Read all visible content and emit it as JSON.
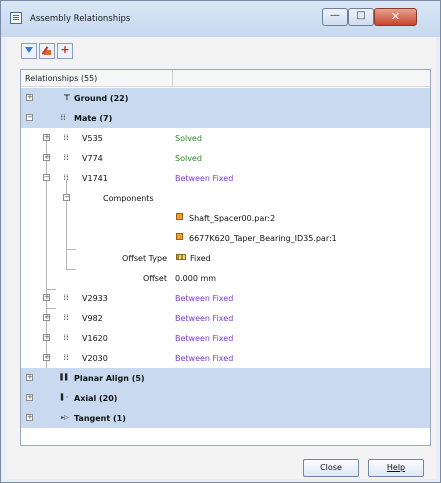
{
  "window": {
    "title": "Assembly Relationships",
    "controls": {
      "minimize": "—",
      "maximize": "□",
      "close": "✕"
    }
  },
  "toolbar": {
    "buttons": [
      {
        "icon": "filter-icon"
      },
      {
        "icon": "edit-relationship-icon"
      },
      {
        "icon": "add-icon",
        "glyph": "+"
      }
    ]
  },
  "tree": {
    "header": "Relationships  (55)",
    "rows": [
      {
        "expander": "+",
        "icon": "ground-icon",
        "glyph": "⊤",
        "label": "Ground  (22)",
        "bold": true,
        "selected": true
      },
      {
        "expander": "−",
        "icon": "mate-icon",
        "glyph": "⁞⁞",
        "label": "Mate  (7)",
        "bold": true,
        "selected": true
      },
      {
        "expander": "+",
        "icon": "mate-icon",
        "glyph": "⁞⁞",
        "label": "V535",
        "status": "Solved",
        "status_type": "solved"
      },
      {
        "expander": "+",
        "icon": "mate-icon",
        "glyph": "⁞⁞",
        "label": "V774",
        "status": "Solved",
        "status_type": "solved"
      },
      {
        "expander": "−",
        "icon": "mate-icon",
        "glyph": "⁞⁞",
        "label": "V1741",
        "status": "Between Fixed",
        "status_type": "between"
      },
      {
        "expander": "−",
        "label": "Components"
      },
      {
        "icon": "part-icon",
        "value": "Shaft_Spacer00.par:2"
      },
      {
        "icon": "part-icon",
        "value": "6677K620_Taper_Bearing_ID35.par:1"
      },
      {
        "label": "Offset Type",
        "value": "Fixed",
        "icon": "fixed-icon"
      },
      {
        "label": "Offset",
        "value": "0.000 mm"
      },
      {
        "expander": "+",
        "icon": "mate-icon",
        "glyph": "⁞⁞",
        "label": "V2933",
        "status": "Between Fixed",
        "status_type": "between"
      },
      {
        "expander": "+",
        "icon": "mate-icon",
        "glyph": "⁞⁞",
        "label": "V982",
        "status": "Between Fixed",
        "status_type": "between"
      },
      {
        "expander": "+",
        "icon": "mate-icon",
        "glyph": "⁞⁞",
        "label": "V1620",
        "status": "Between Fixed",
        "status_type": "between"
      },
      {
        "expander": "+",
        "icon": "mate-icon",
        "glyph": "⁞⁞",
        "label": "V2030",
        "status": "Between Fixed",
        "status_type": "between"
      },
      {
        "expander": "+",
        "icon": "planar-align-icon",
        "glyph": "▌▌",
        "label": "Planar Align  (5)",
        "bold": true,
        "selected": true
      },
      {
        "expander": "+",
        "icon": "axial-icon",
        "glyph": "▌◦",
        "label": "Axial  (20)",
        "bold": true,
        "selected": true
      },
      {
        "expander": "+",
        "icon": "tangent-icon",
        "glyph": "▸▷",
        "label": "Tangent  (1)",
        "bold": true,
        "selected": true
      }
    ]
  },
  "buttons": {
    "close": "Close",
    "help": "Help"
  },
  "colors": {
    "selection": "#c8d9f0",
    "solved": "#2a8a2a",
    "between_fixed": "#7a3bd0"
  }
}
